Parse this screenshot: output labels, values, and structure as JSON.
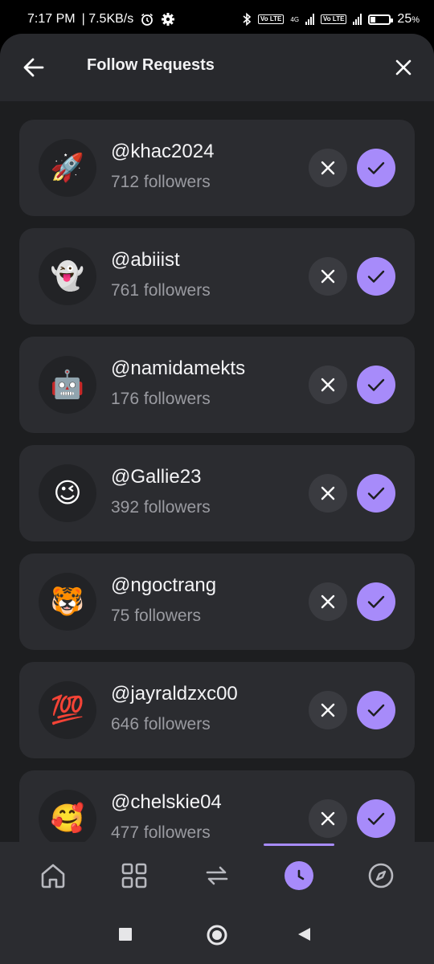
{
  "status_bar": {
    "time": "7:17 PM",
    "net_speed": "| 7.5KB/s",
    "lte1": "Vo LTE",
    "net_type": "4G",
    "lte2": "Vo LTE",
    "battery": "25",
    "battery_level_percent": 25
  },
  "header": {
    "title": "Follow Requests",
    "back_icon": "arrow-left-icon",
    "close_icon": "close-icon"
  },
  "requests": [
    {
      "avatar": "🚀",
      "username": "@khac2024",
      "followers": "712 followers"
    },
    {
      "avatar": "👻",
      "username": "@abiiist",
      "followers": "761 followers"
    },
    {
      "avatar": "🤖",
      "username": "@namidamekts",
      "followers": "176 followers"
    },
    {
      "avatar": "😉",
      "username": "@Gallie23",
      "followers": "392 followers"
    },
    {
      "avatar": "🐯",
      "username": "@ngoctrang",
      "followers": "75 followers"
    },
    {
      "avatar": "💯",
      "username": "@jayraldzxc00",
      "followers": "646 followers"
    },
    {
      "avatar": "🥰",
      "username": "@chelskie04",
      "followers": "477 followers"
    }
  ],
  "bottom_nav": {
    "items": [
      "home-icon",
      "grid-icon",
      "repeat-icon",
      "clock-icon",
      "compass-icon"
    ],
    "active": "clock-icon"
  },
  "colors": {
    "accent": "#a78bfa",
    "card": "#2b2c30",
    "background": "#1d1e20"
  }
}
